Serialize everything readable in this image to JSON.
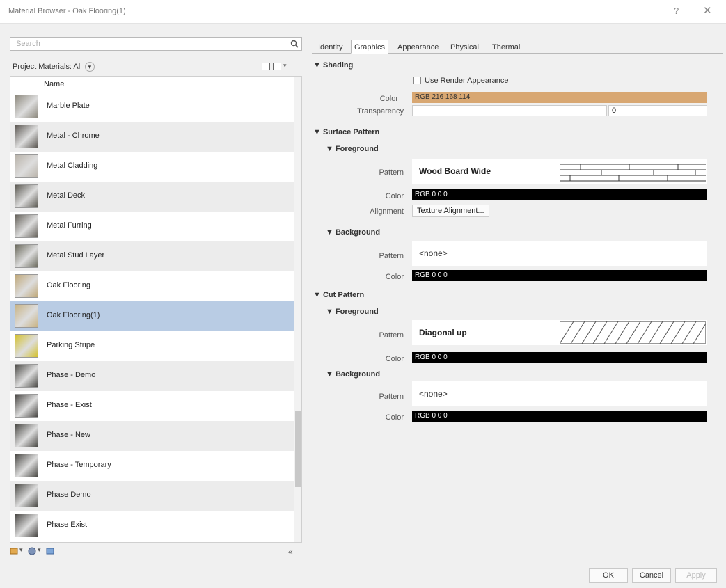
{
  "window": {
    "title": "Material Browser - Oak Flooring(1)",
    "help": "?",
    "close": "✕"
  },
  "search": {
    "placeholder": "Search"
  },
  "filter": {
    "label": "Project Materials: All",
    "pill": "▾"
  },
  "list": {
    "header": "Name",
    "items": [
      {
        "label": "Marble Plate",
        "thumb": "#8e8a7f"
      },
      {
        "label": "Metal - Chrome",
        "thumb": "#5e5a55"
      },
      {
        "label": "Metal Cladding",
        "thumb": "#b9b3aa"
      },
      {
        "label": "Metal Deck",
        "thumb": "#5c5a53"
      },
      {
        "label": "Metal Furring",
        "thumb": "#66625b"
      },
      {
        "label": "Metal Stud Layer",
        "thumb": "#6b6a5d"
      },
      {
        "label": "Oak Flooring",
        "thumb": "#bfa879"
      },
      {
        "label": "Oak Flooring(1)",
        "thumb": "#c8b384"
      },
      {
        "label": "Parking Stripe",
        "thumb": "#d4c12e"
      },
      {
        "label": "Phase - Demo",
        "thumb": "#4d4c48"
      },
      {
        "label": "Phase - Exist",
        "thumb": "#4a4845"
      },
      {
        "label": "Phase - New",
        "thumb": "#4c4b47"
      },
      {
        "label": "Phase - Temporary",
        "thumb": "#4b4a46"
      },
      {
        "label": "Phase Demo",
        "thumb": "#4d4c48"
      },
      {
        "label": "Phase Exist",
        "thumb": "#4a4845"
      }
    ],
    "selected_index": 7
  },
  "tabs": [
    "Identity",
    "Graphics",
    "Appearance",
    "Physical",
    "Thermal"
  ],
  "active_tab": "Graphics",
  "shading": {
    "title": "▼ Shading",
    "use_render": "Use Render Appearance",
    "color_label": "Color",
    "color_value": "RGB 216 168 114",
    "color_hex": "#d8a772",
    "transparency_label": "Transparency",
    "transparency_value": "0"
  },
  "surface": {
    "title": "▼ Surface Pattern",
    "foreground": {
      "title": "▼ Foreground",
      "pattern_label": "Pattern",
      "pattern_value": "Wood Board Wide",
      "color_label": "Color",
      "color_value": "RGB 0 0 0",
      "alignment_label": "Alignment",
      "alignment_button": "Texture Alignment..."
    },
    "background": {
      "title": "▼ Background",
      "pattern_label": "Pattern",
      "pattern_value": "<none>",
      "color_label": "Color",
      "color_value": "RGB 0 0 0"
    }
  },
  "cut": {
    "title": "▼ Cut Pattern",
    "foreground": {
      "title": "▼ Foreground",
      "pattern_label": "Pattern",
      "pattern_value": "Diagonal up",
      "color_label": "Color",
      "color_value": "RGB 0 0 0"
    },
    "background": {
      "title": "▼ Background",
      "pattern_label": "Pattern",
      "pattern_value": "<none>",
      "color_label": "Color",
      "color_value": "RGB 0 0 0"
    }
  },
  "buttons": {
    "ok": "OK",
    "cancel": "Cancel",
    "apply": "Apply"
  },
  "collapse": "«"
}
